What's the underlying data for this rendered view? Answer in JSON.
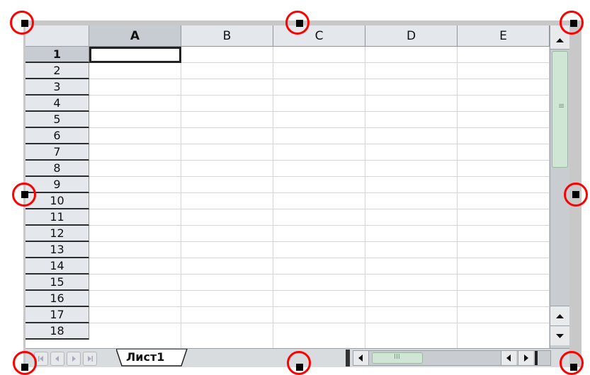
{
  "spreadsheet": {
    "columns": [
      "A",
      "B",
      "C",
      "D",
      "E"
    ],
    "active_column": "A",
    "rows": [
      "1",
      "2",
      "3",
      "4",
      "5",
      "6",
      "7",
      "8",
      "9",
      "10",
      "11",
      "12",
      "13",
      "14",
      "15",
      "16",
      "17",
      "18"
    ],
    "active_row": "1",
    "active_cell": "A1"
  },
  "tabs": {
    "sheet_name": "Лист1"
  },
  "scroll": {
    "horizontal_grip": "III",
    "vertical_grip": "≡"
  },
  "icons": {
    "first_sheet": "first-sheet-icon",
    "prev_sheet": "previous-sheet-icon",
    "next_sheet": "next-sheet-icon",
    "last_sheet": "last-sheet-icon",
    "scroll_up": "chevron-up-icon",
    "scroll_down": "chevron-down-icon",
    "scroll_left": "chevron-left-icon",
    "scroll_right": "chevron-right-icon"
  },
  "colors": {
    "header_bg": "#e4e7ec",
    "active_header_bg": "#c7ccd2",
    "scroll_thumb": "#cfe6d4",
    "handle_ring": "#ff0000",
    "handle": "#000000"
  }
}
